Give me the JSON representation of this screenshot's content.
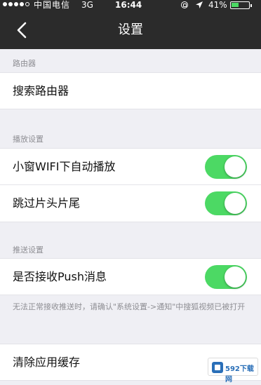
{
  "status_bar": {
    "carrier": "中国电信",
    "network": "3G",
    "time": "16:44",
    "battery_percent": "41%",
    "signal_strength": 4,
    "battery_level": 0.41,
    "icons": [
      "lock-rotation-icon",
      "location-icon",
      "battery-icon"
    ]
  },
  "nav": {
    "title": "设置",
    "back_icon": "chevron-left-icon"
  },
  "sections": {
    "router": {
      "header": "路由器",
      "items": {
        "search_router": "搜索路由器"
      }
    },
    "playback": {
      "header": "播放设置",
      "items": {
        "wifi_autoplay": {
          "label": "小窗WIFI下自动播放",
          "on": true
        },
        "skip_intro": {
          "label": "跳过片头片尾",
          "on": true
        }
      }
    },
    "push": {
      "header": "推送设置",
      "items": {
        "receive_push": {
          "label": "是否接收Push消息",
          "on": true
        }
      },
      "note": "无法正常接收推送时，请确认\"系统设置->通知\"中搜狐视频已被打开"
    },
    "cache": {
      "items": {
        "clear_cache": "清除应用缓存"
      }
    }
  },
  "colors": {
    "nav_background": "#2b2b2b",
    "toggle_on": "#4cd964",
    "page_background": "#efeff4"
  },
  "watermark": {
    "text": "592下载网"
  }
}
